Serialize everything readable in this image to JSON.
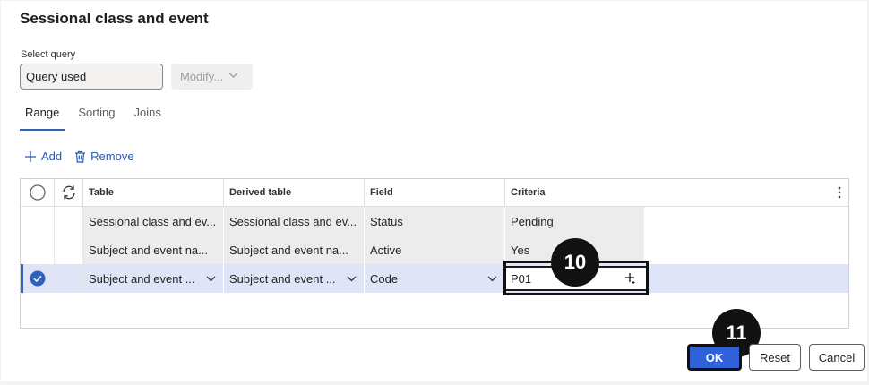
{
  "dialog": {
    "title": "Sessional class and event"
  },
  "query": {
    "label": "Select query",
    "value": "Query used",
    "modify_label": "Modify..."
  },
  "tabs": [
    {
      "label": "Range"
    },
    {
      "label": "Sorting"
    },
    {
      "label": "Joins"
    }
  ],
  "toolbar": {
    "add_label": "Add",
    "remove_label": "Remove"
  },
  "grid": {
    "columns": [
      "Table",
      "Derived table",
      "Field",
      "Criteria"
    ],
    "rows": [
      {
        "table": "Sessional class and ev...",
        "derived": "Sessional class and ev...",
        "field": "Status",
        "criteria": "Pending"
      },
      {
        "table": "Subject and event na...",
        "derived": "Subject and event na...",
        "field": "Active",
        "criteria": "Yes"
      },
      {
        "table": "Subject and event ...",
        "derived": "Subject and event ...",
        "field": "Code",
        "criteria": "P01"
      }
    ]
  },
  "callouts": {
    "step_a": "10",
    "step_b": "11"
  },
  "buttons": {
    "ok": "OK",
    "reset": "Reset",
    "cancel": "Cancel"
  },
  "colors": {
    "accent": "#2f62d9",
    "selected_row": "#dfe5f6",
    "link": "#2b59b3"
  }
}
